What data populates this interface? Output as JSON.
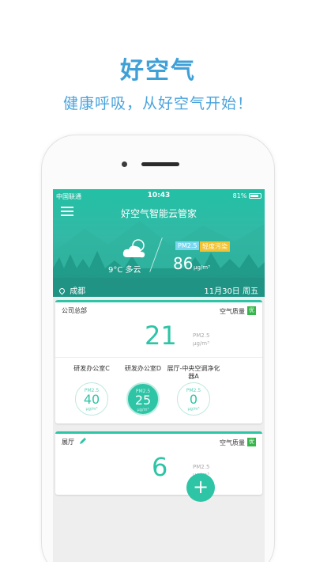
{
  "promo": {
    "title": "好空气",
    "subtitle": "健康呼吸，从好空气开始！"
  },
  "status_bar": {
    "carrier": "中国联通",
    "time": "10:43",
    "battery": "81%"
  },
  "header": {
    "title": "好空气智能云管家"
  },
  "weather": {
    "icon": "partly-cloudy-icon",
    "temperature": "9°C",
    "condition": "多云",
    "pm_label": "PM2.5",
    "level": "轻度污染",
    "aqi": "86",
    "unit": "μg/m³",
    "location": "成都",
    "date": "11月30日 周五"
  },
  "cards": [
    {
      "name": "公司总部",
      "aq_label": "空气质量",
      "aq_badge": "优",
      "value": "21",
      "pm_label": "PM2.5",
      "unit": "μg/m³",
      "rooms": [
        {
          "name": "研发办公室C",
          "pm_label": "PM2.5",
          "value": "40",
          "unit": "μg/m³"
        },
        {
          "name": "研发办公室D",
          "pm_label": "PM2.5",
          "value": "25",
          "unit": "μg/m³"
        },
        {
          "name": "展厅-中央空调净化器A",
          "pm_label": "PM2.5",
          "value": "0",
          "unit": "μg/m³"
        }
      ]
    },
    {
      "name": "展厅",
      "aq_label": "空气质量",
      "aq_badge": "优",
      "value": "6",
      "pm_label": "PM2.5",
      "unit": "μg/m³"
    }
  ],
  "fab": {
    "label": "+"
  },
  "colors": {
    "accent": "#2ec4a6",
    "promo_text": "#3fa0d8",
    "badge_good": "#35b54a",
    "badge_warn": "#f1c232"
  }
}
